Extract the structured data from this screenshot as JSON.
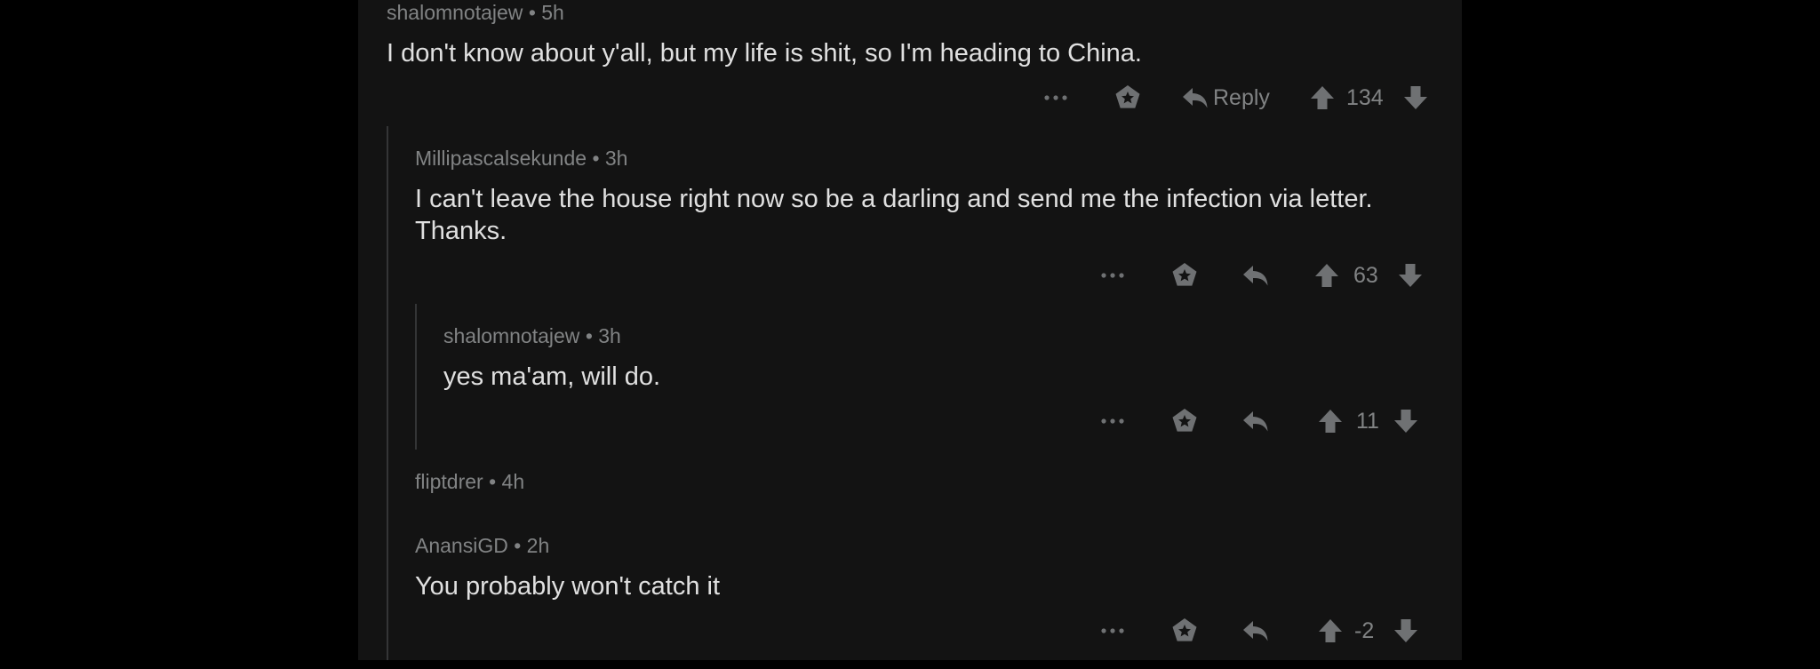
{
  "comments": [
    {
      "author": "shalomnotajew",
      "meta": "• 5h",
      "body": "I don't know about y'all, but my life is shit, so I'm heading to China.",
      "reply_label": "Reply",
      "score": "134"
    },
    {
      "author": "Millipascalsekunde",
      "meta": "• 3h",
      "body": "I can't leave the house right now so be a darling and send me the infection via letter. Thanks.",
      "score": "63"
    },
    {
      "author": "shalomnotajew",
      "meta": "• 3h",
      "body": "yes ma'am, will do.",
      "score": "11"
    },
    {
      "author": "fliptdrer",
      "meta": "• 4h"
    },
    {
      "author": "AnansiGD",
      "meta": "• 2h",
      "body": "You probably won't catch it",
      "score": "-2"
    }
  ],
  "icons": {
    "more": "more-options-icon",
    "award": "award-icon",
    "reply": "reply-arrow-icon",
    "upvote": "upvote-arrow-icon",
    "downvote": "downvote-arrow-icon"
  },
  "colors": {
    "page_bg": "#000000",
    "panel_bg": "#131313",
    "body_text": "#e0e0e0",
    "meta_text": "#818384",
    "icon": "#6f7173",
    "thread_line": "#343536"
  }
}
